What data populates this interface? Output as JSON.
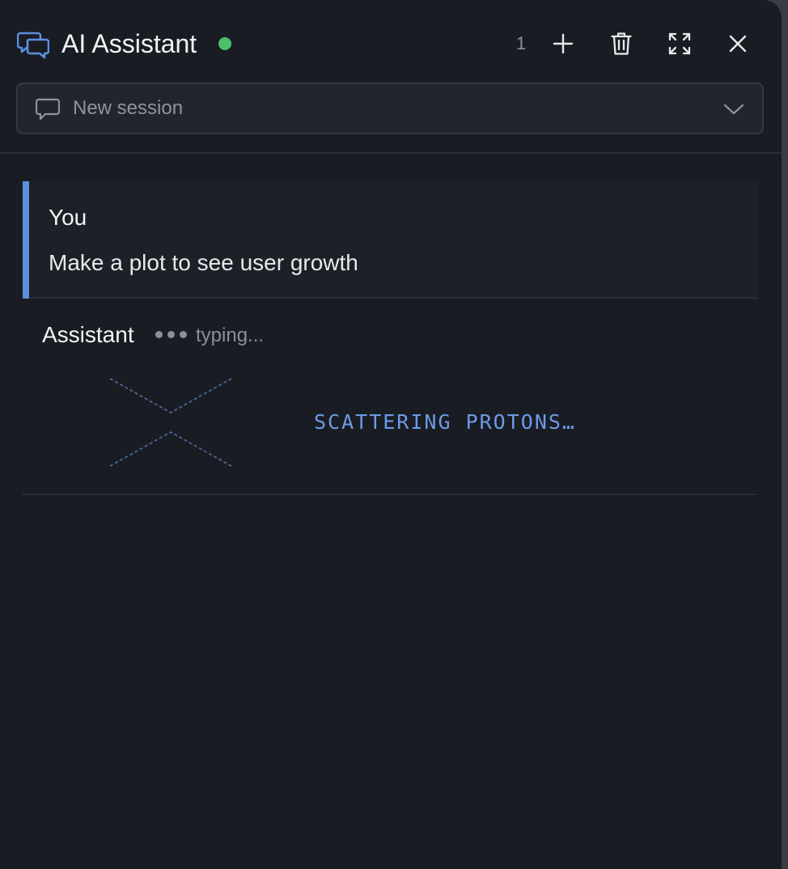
{
  "header": {
    "title": "AI Assistant",
    "status": "online",
    "session_count": "1",
    "icons": {
      "title": "chat-bubbles-icon",
      "new": "plus-icon",
      "delete": "trash-icon",
      "expand": "expand-icon",
      "close": "close-icon"
    }
  },
  "session_select": {
    "icon": "chat-bubble-icon",
    "value": "New session",
    "chevron": "chevron-down-icon"
  },
  "messages": [
    {
      "role": "user",
      "author": "You",
      "text": "Make a plot to see user growth"
    },
    {
      "role": "assistant",
      "author": "Assistant",
      "status": "typing...",
      "loading_text": "SCATTERING PROTONS…"
    }
  ],
  "colors": {
    "panel_bg": "#1a1c23",
    "accent": "#5c8fe0",
    "status_online": "#4cbf6a",
    "loading_text": "#6b9be8",
    "muted_text": "#8a8f99"
  }
}
